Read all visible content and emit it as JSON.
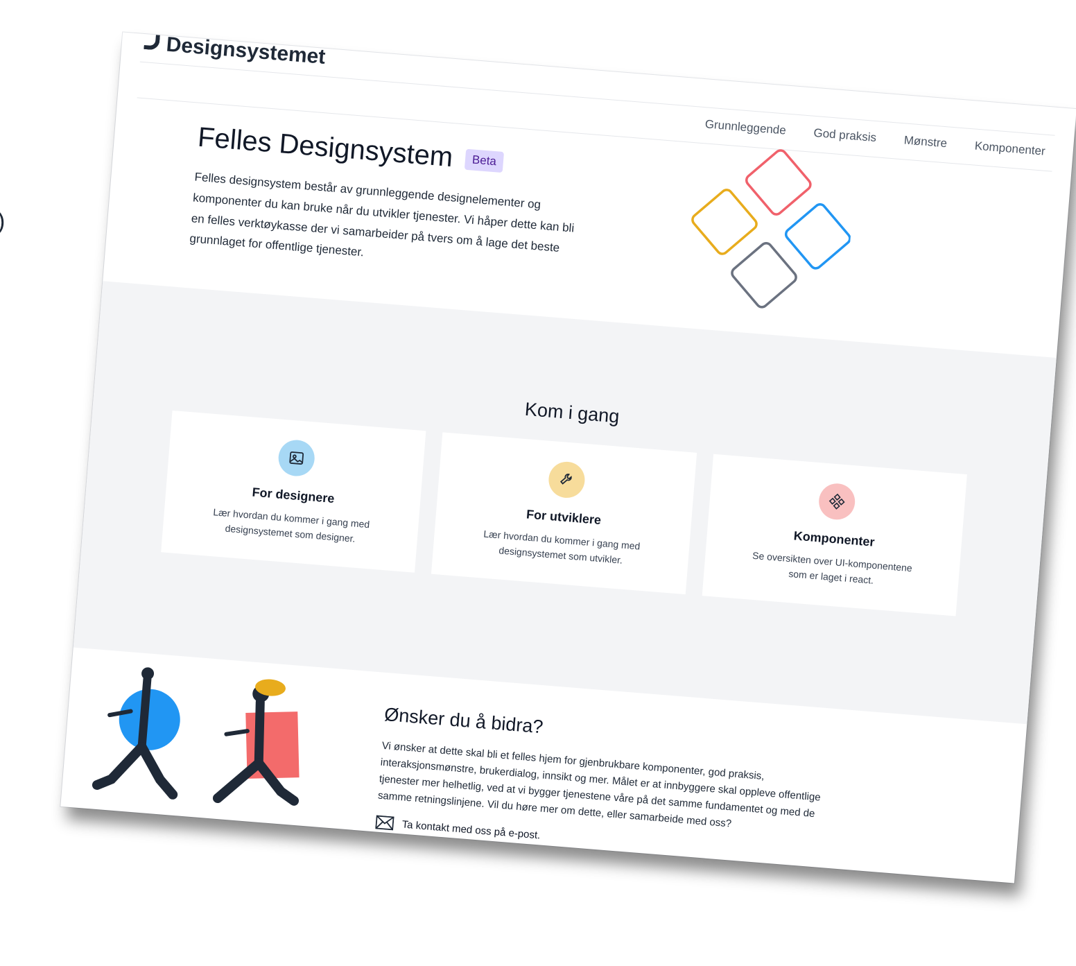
{
  "header": {
    "brand": "Designsystemet",
    "nav": [
      "Grunnleggende",
      "God praksis",
      "Mønstre",
      "Komponenter"
    ]
  },
  "hero": {
    "title": "Felles Designsystem",
    "badge": "Beta",
    "description": "Felles designsystem består av grunnleggende designelementer og komponenter du kan bruke når du utvikler tjenester. Vi håper dette kan bli en felles verktøykasse der vi samarbeider på tvers om å lage det beste grunnlaget for offentlige tjenester."
  },
  "start": {
    "heading": "Kom i gang",
    "cards": [
      {
        "title": "For designere",
        "text": "Lær hvordan du kommer i gang med designsystemet som designer.",
        "icon": "image-icon",
        "color": "#a7d8f5"
      },
      {
        "title": "For utviklere",
        "text": "Lær hvordan du kommer i gang med designsystemet som utvikler.",
        "icon": "wrench-icon",
        "color": "#f7dc9b"
      },
      {
        "title": "Komponenter",
        "text": "Se oversikten over UI-komponentene som er laget i react.",
        "icon": "components-icon",
        "color": "#f9c0c0"
      }
    ]
  },
  "contribute": {
    "heading": "Ønsker du å bidra?",
    "text": "Vi ønsker at dette skal bli et felles hjem for gjenbrukbare komponenter, god praksis, interaksjonsmønstre, brukerdialog, innsikt og mer. Målet er at innbyggere skal oppleve offentlige tjenester mer helhetlig, ved at vi bygger tjenestene våre på det samme fundamentet og med de samme retningslinjene. Vil du høre mer om dette, eller samarbeide med oss?",
    "contact": "Ta kontakt med oss på e-post."
  },
  "colors": {
    "diamond_red": "#f0616b",
    "diamond_yellow": "#e8ac1d",
    "diamond_blue": "#2196f3",
    "diamond_gray": "#6b7280",
    "badge_bg": "#ddd6fe"
  }
}
